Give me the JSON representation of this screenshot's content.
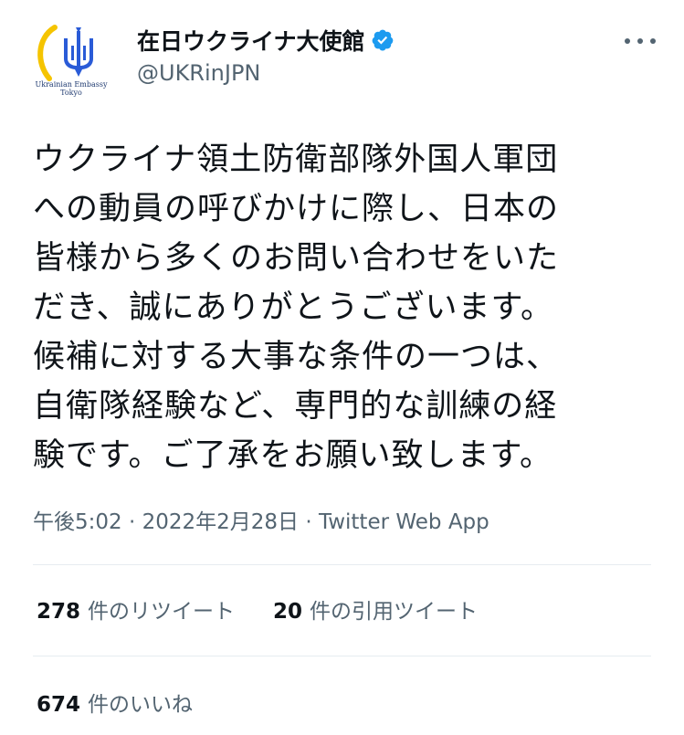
{
  "author": {
    "display_name": "在日ウクライナ大使館",
    "handle": "@UKRinJPN",
    "verified": true,
    "avatar": {
      "caption_line1": "Ukrainian Embassy",
      "caption_line2": "Tokyo",
      "icon": "ukraine-trident-icon"
    }
  },
  "tweet": {
    "text_lines": [
      "ウクライナ領土防衛部隊外国人軍団",
      "への動員の呼びかけに際し、日本の",
      "皆様から多くのお問い合わせをいた",
      "だき、誠にありがとうございます。",
      "候補に対する大事な条件の一つは、",
      "自衛隊経験など、専門的な訓練の経",
      "験です。ご了承をお願い致します。"
    ],
    "time": "午後5:02",
    "date": "2022年2月28日",
    "source": "Twitter Web App",
    "separator": "·"
  },
  "stats": {
    "retweets_count": "278",
    "retweets_label": "件のリツイート",
    "quotes_count": "20",
    "quotes_label": "件の引用ツイート",
    "likes_count": "674",
    "likes_label": "件のいいね"
  },
  "colors": {
    "text_primary": "#0f1419",
    "text_secondary": "#536471",
    "verified_blue": "#1d9bf0",
    "divider": "#e6ecf0",
    "brand_blue": "#2a5bd7",
    "brand_yellow": "#f5c400"
  }
}
